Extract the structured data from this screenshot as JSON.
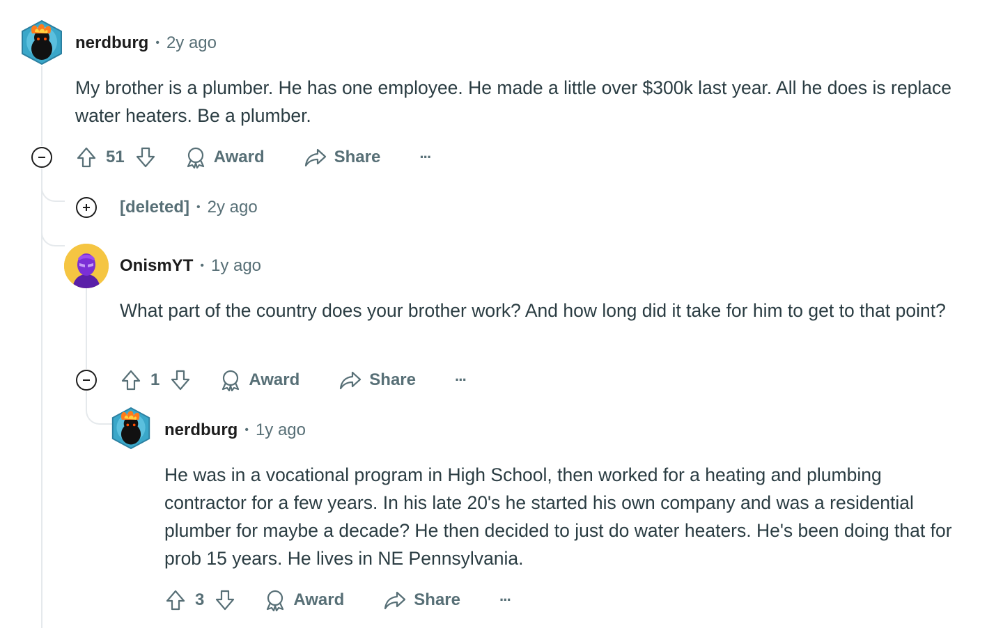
{
  "comments": [
    {
      "username": "nerdburg",
      "separator": "•",
      "time": "2y ago",
      "body": "My brother is a plumber. He has one employee. He made a little over $300k last year. All he does is replace water heaters. Be a plumber.",
      "votes": "51",
      "award_label": "Award",
      "share_label": "Share",
      "more_label": "···"
    },
    {
      "username": "[deleted]",
      "separator": "•",
      "time": "2y ago"
    },
    {
      "username": "OnismYT",
      "separator": "•",
      "time": "1y ago",
      "body": "What part of the country does your brother work? And how long did it take for him to get to that point?",
      "votes": "1",
      "award_label": "Award",
      "share_label": "Share",
      "more_label": "···"
    },
    {
      "username": "nerdburg",
      "separator": "•",
      "time": "1y ago",
      "body": "He was in a vocational program in High School, then worked for a heating and plumbing contractor for a few years. In his late 20's he started his own company and was a residential plumber for maybe a decade? He then decided to just do water heaters. He's been doing that for prob 15 years. He lives in NE Pennsylvania.",
      "votes": "3",
      "award_label": "Award",
      "share_label": "Share",
      "more_label": "···"
    }
  ],
  "colors": {
    "text_primary": "#1c1c1c",
    "text_secondary": "#576f76",
    "body_text": "#2a3c42",
    "thread_line": "#e5e9ec",
    "onismyt_avatar_bg": "#f5c542"
  },
  "icons": [
    "upvote-icon",
    "downvote-icon",
    "award-icon",
    "share-icon",
    "more-icon",
    "collapse-icon",
    "expand-icon"
  ]
}
